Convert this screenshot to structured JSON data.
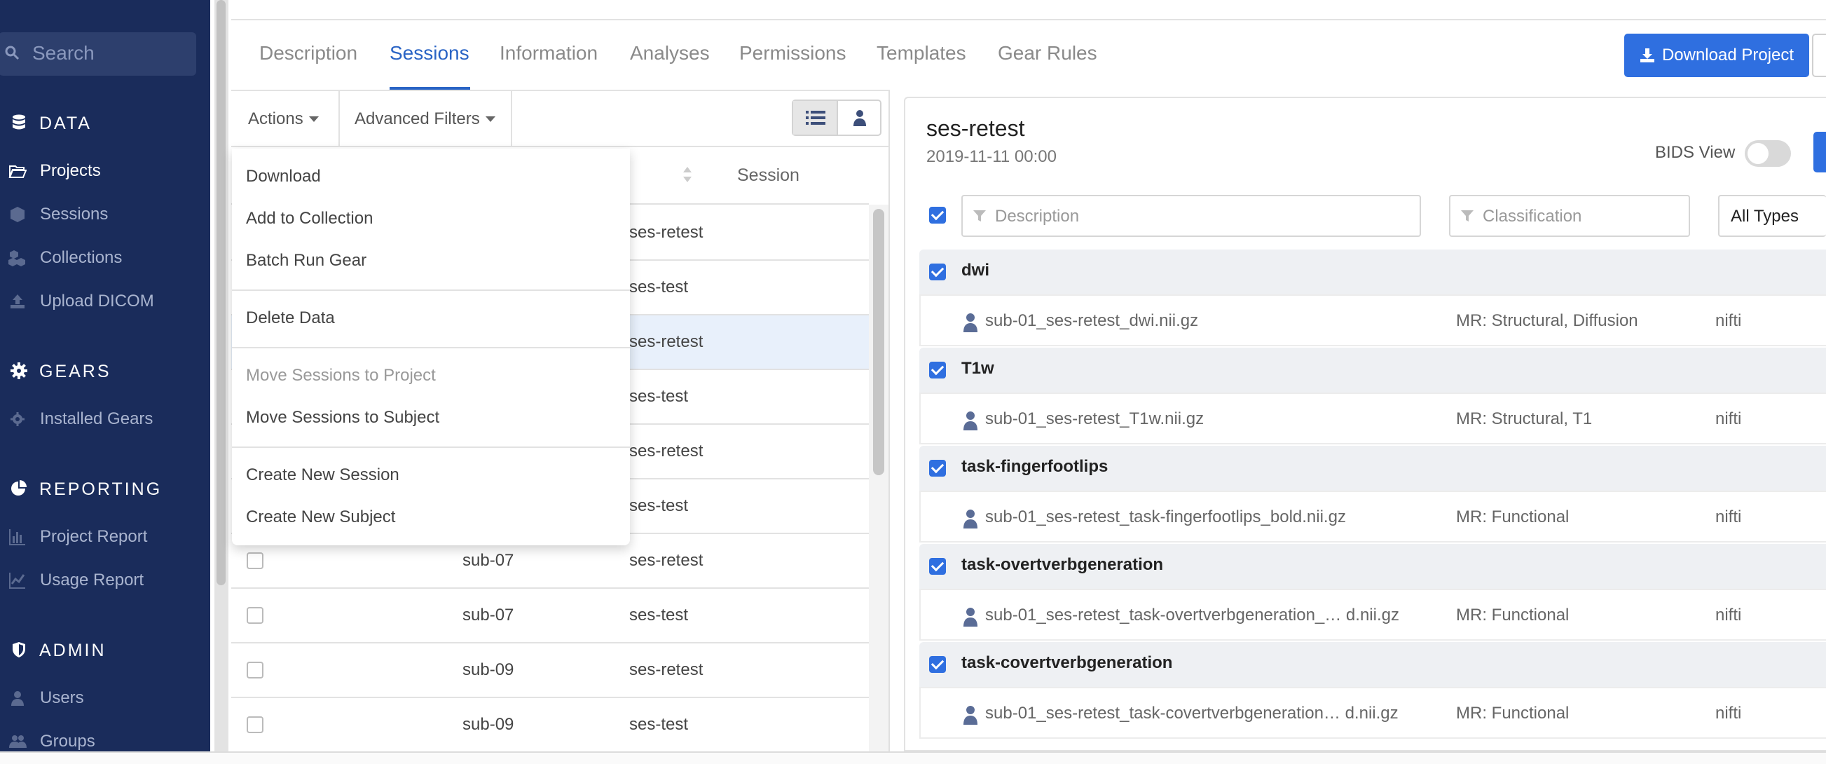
{
  "sidebar": {
    "search_placeholder": "Search",
    "sections": [
      {
        "label": "DATA"
      },
      {
        "label": "GEARS"
      },
      {
        "label": "REPORTING"
      },
      {
        "label": "ADMIN"
      }
    ],
    "items": [
      {
        "label": "Projects",
        "icon": "folder-open-icon",
        "active": true
      },
      {
        "label": "Sessions",
        "icon": "cube-icon"
      },
      {
        "label": "Collections",
        "icon": "cubes-icon"
      },
      {
        "label": "Upload DICOM",
        "icon": "upload-icon"
      },
      {
        "label": "Installed Gears",
        "icon": "gear-icon"
      },
      {
        "label": "Project Report",
        "icon": "bar-chart-icon"
      },
      {
        "label": "Usage Report",
        "icon": "line-chart-icon"
      },
      {
        "label": "Users",
        "icon": "user-icon"
      },
      {
        "label": "Groups",
        "icon": "users-icon"
      }
    ]
  },
  "tabs": [
    "Description",
    "Sessions",
    "Information",
    "Analyses",
    "Permissions",
    "Templates",
    "Gear Rules"
  ],
  "active_tab": "Sessions",
  "download_button": "Download Project",
  "toolbar": {
    "actions_label": "Actions",
    "advanced_filters_label": "Advanced Filters"
  },
  "table": {
    "session_header": "Session",
    "rows": [
      {
        "subject": "",
        "session": "ses-retest"
      },
      {
        "subject": "",
        "session": "ses-test"
      },
      {
        "subject": "",
        "session": "ses-retest",
        "selected": true
      },
      {
        "subject": "",
        "session": "ses-test"
      },
      {
        "subject": "",
        "session": "ses-retest"
      },
      {
        "subject": "",
        "session": "ses-test"
      },
      {
        "subject": "sub-07",
        "session": "ses-retest"
      },
      {
        "subject": "sub-07",
        "session": "ses-test"
      },
      {
        "subject": "sub-09",
        "session": "ses-retest"
      },
      {
        "subject": "sub-09",
        "session": "ses-test"
      }
    ]
  },
  "actions_menu": {
    "groups": [
      [
        "Download",
        "Add to Collection",
        "Batch Run Gear"
      ],
      [
        "Delete Data"
      ],
      [
        "Move Sessions to Project",
        "Move Sessions to Subject"
      ],
      [
        "Create New Session",
        "Create New Subject"
      ]
    ],
    "disabled": [
      "Move Sessions to Project"
    ]
  },
  "detail": {
    "title": "ses-retest",
    "date": "2019-11-11 00:00",
    "bids_view_label": "BIDS View",
    "description_placeholder": "Description",
    "classification_placeholder": "Classification",
    "type_filter": "All Types",
    "groups": [
      {
        "name": "dwi",
        "file": "sub-01_ses-retest_dwi.nii.gz",
        "classification": "MR: Structural, Diffusion",
        "type": "nifti"
      },
      {
        "name": "T1w",
        "file": "sub-01_ses-retest_T1w.nii.gz",
        "classification": "MR: Structural, T1",
        "type": "nifti"
      },
      {
        "name": "task-fingerfootlips",
        "file": "sub-01_ses-retest_task-fingerfootlips_bold.nii.gz",
        "classification": "MR: Functional",
        "type": "nifti"
      },
      {
        "name": "task-overtverbgeneration",
        "file": "sub-01_ses-retest_task-overtverbgeneration_… d.nii.gz",
        "classification": "MR: Functional",
        "type": "nifti"
      },
      {
        "name": "task-covertverbgeneration",
        "file": "sub-01_ses-retest_task-covertverbgeneration… d.nii.gz",
        "classification": "MR: Functional",
        "type": "nifti"
      }
    ]
  },
  "colors": {
    "sidebar_bg": "#1a2c5b",
    "accent": "#2f6fe0",
    "active_tab": "#2a64c5",
    "selected_row": "#e8f0fb"
  }
}
